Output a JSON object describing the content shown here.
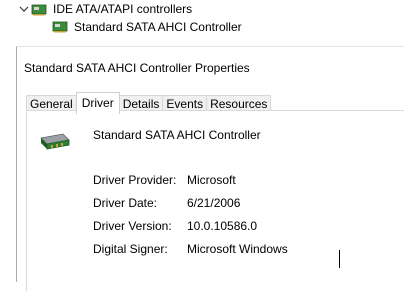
{
  "tree": {
    "parent_label": "IDE ATA/ATAPI controllers",
    "child_label": "Standard SATA AHCI Controller",
    "parent_icon": "ide-controller-icon",
    "child_icon": "sata-controller-icon",
    "expand_icon": "chevron-down-icon"
  },
  "dialog": {
    "title": "Standard SATA AHCI Controller Properties",
    "tabs": [
      {
        "label": "General",
        "active": false
      },
      {
        "label": "Driver",
        "active": true
      },
      {
        "label": "Details",
        "active": false
      },
      {
        "label": "Events",
        "active": false
      },
      {
        "label": "Resources",
        "active": false
      }
    ],
    "device_name": "Standard SATA AHCI Controller",
    "device_icon": "sata-controller-icon",
    "properties": [
      {
        "label": "Driver Provider:",
        "value": "Microsoft"
      },
      {
        "label": "Driver Date:",
        "value": "6/21/2006"
      },
      {
        "label": "Driver Version:",
        "value": "10.0.10586.0"
      },
      {
        "label": "Digital Signer:",
        "value": "Microsoft Windows"
      }
    ]
  },
  "colors": {
    "tab_border": "#d9d9d9",
    "tab_inactive_bg": "#f0f0f0",
    "chip_green": "#2e7d32"
  }
}
